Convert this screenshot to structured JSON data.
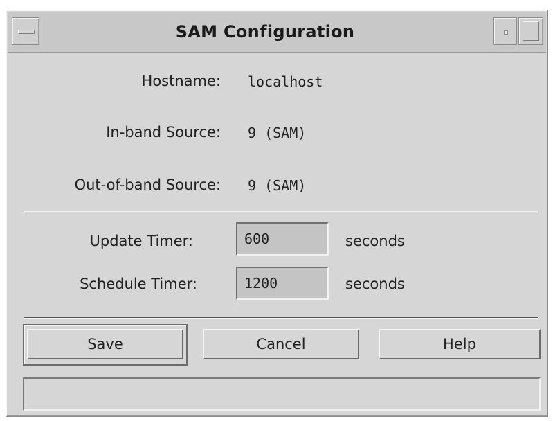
{
  "window": {
    "title": "SAM Configuration"
  },
  "info": {
    "hostname_label": "Hostname:",
    "hostname_value": "localhost",
    "inband_label": "In-band Source:",
    "inband_value": "9 (SAM)",
    "outband_label": "Out-of-band Source:",
    "outband_value": "9 (SAM)"
  },
  "timers": {
    "update_label": "Update Timer:",
    "update_value": "600",
    "update_unit": "seconds",
    "schedule_label": "Schedule Timer:",
    "schedule_value": "1200",
    "schedule_unit": "seconds"
  },
  "buttons": {
    "save": "Save",
    "cancel": "Cancel",
    "help": "Help"
  },
  "status": {
    "message": ""
  },
  "icons": {
    "window_menu": "window-menu-icon",
    "minimize": "minimize-icon",
    "maximize": "maximize-icon"
  }
}
